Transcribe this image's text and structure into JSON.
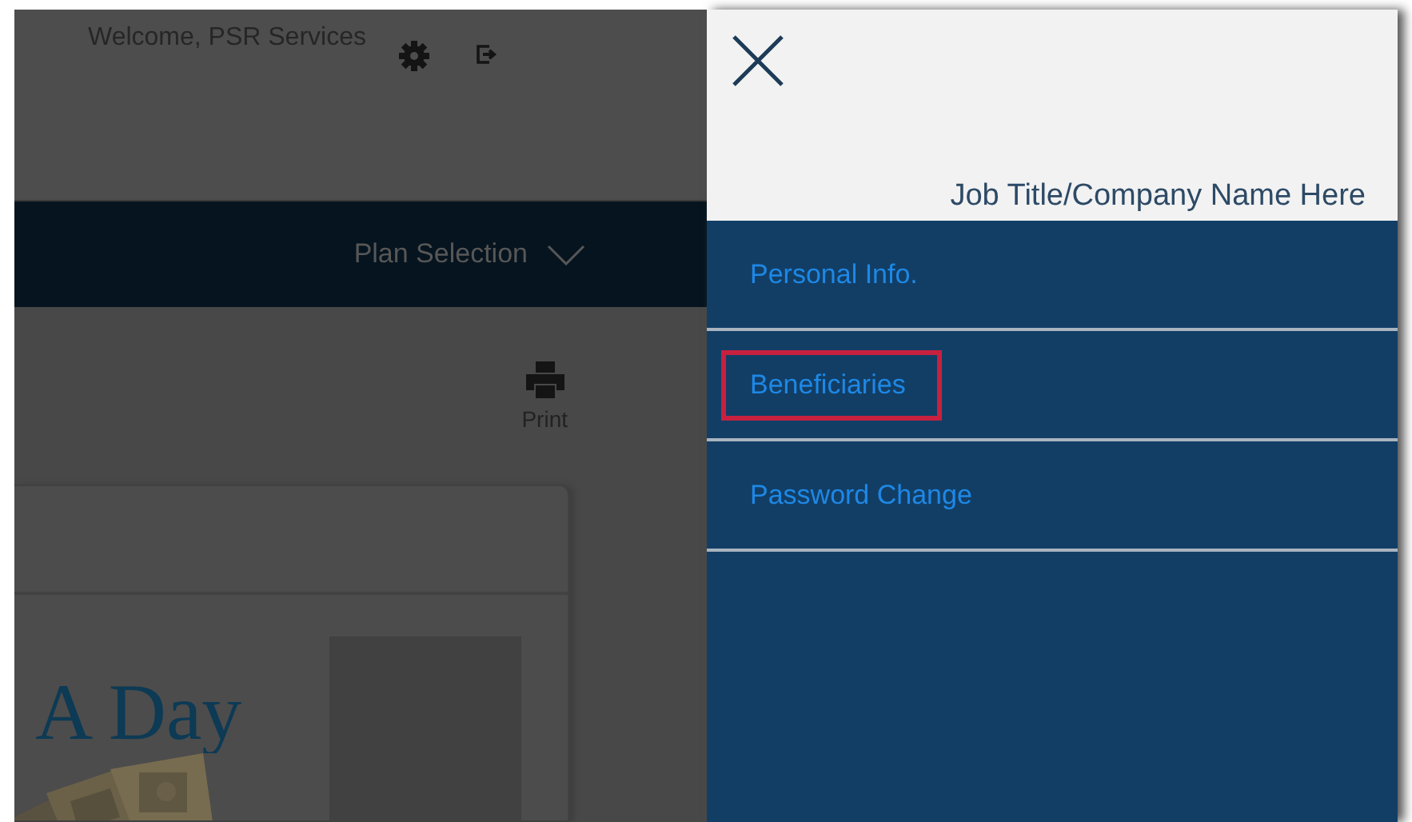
{
  "header": {
    "welcome": "Welcome,  PSR Services"
  },
  "nav": {
    "label": "Plan Selection"
  },
  "toolbar": {
    "print": "Print"
  },
  "card": {
    "heading": "A Day"
  },
  "drawer": {
    "subtitle": "Job Title/Company Name Here",
    "items": [
      {
        "label": "Personal Info.",
        "highlighted": false
      },
      {
        "label": "Beneficiaries",
        "highlighted": true
      },
      {
        "label": "Password Change",
        "highlighted": false
      }
    ]
  }
}
